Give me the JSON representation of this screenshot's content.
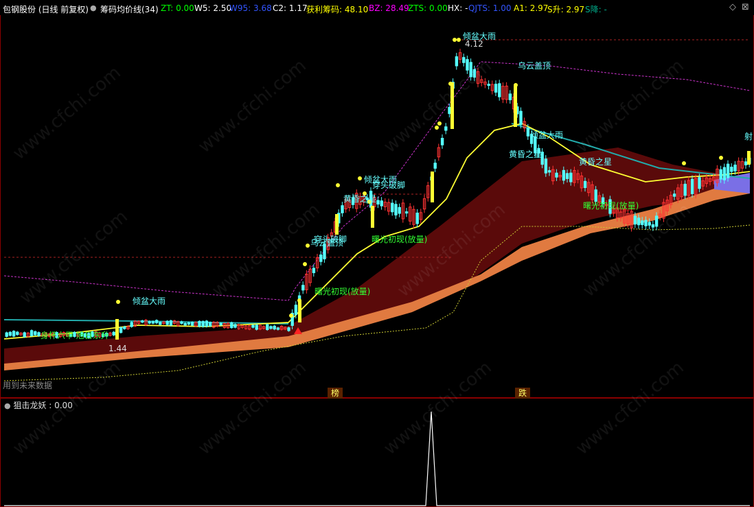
{
  "header": {
    "stock_title": "包钢股份 (日线 前复权)",
    "indicator_name": "筹码均价线(34)",
    "params": [
      {
        "label": "ZT: 0.00",
        "color": "#00ff00"
      },
      {
        "label": "W5: 2.50",
        "color": "#ffffff"
      },
      {
        "label": "W95: 3.68",
        "color": "#3355ff"
      },
      {
        "label": "C2: 1.17",
        "color": "#ffffff"
      },
      {
        "label": "获利筹码: 48.10",
        "color": "#ffff00"
      },
      {
        "label": "BZ: 28.49",
        "color": "#ff00ff"
      },
      {
        "label": "ZTS: 0.00",
        "color": "#00ff00"
      },
      {
        "label": "HX: -",
        "color": "#ffffff"
      },
      {
        "label": "QJTS: 1.00",
        "color": "#3355ff"
      },
      {
        "label": "A1: 2.97",
        "color": "#ffff00"
      },
      {
        "label": "S升: 2.97",
        "color": "#ffff00"
      },
      {
        "label": "S降: -",
        "color": "#00aa88"
      }
    ]
  },
  "main_chart": {
    "high_price_label": "4.12",
    "low_price_label": "1.44",
    "future_data_note": "用到未来数据",
    "pills": [
      "榜",
      "跌"
    ],
    "annotations": [
      {
        "text": "倾盆大雨",
        "color": "#66ffff"
      },
      {
        "text": "乌云盖顶",
        "color": "#66ffff"
      },
      {
        "text": "倾盆大雨",
        "color": "#66ffff"
      },
      {
        "text": "黄昏之星",
        "color": "#66ffff"
      },
      {
        "text": "曙光初现(放量)",
        "color": "#33ff33"
      },
      {
        "text": "倾盆大雨",
        "color": "#66ffff"
      },
      {
        "text": "穿头破脚",
        "color": "#66ffff"
      },
      {
        "text": "黄昏之星",
        "color": "#66ffff"
      },
      {
        "text": "曙光初现(放量)",
        "color": "#33ff33"
      },
      {
        "text": "穿头破脚",
        "color": "#66ffff"
      },
      {
        "text": "乌云盖顶",
        "color": "#66ffff"
      },
      {
        "text": "曙光初现(放量)",
        "color": "#33ff33"
      },
      {
        "text": "倾盆大雨",
        "color": "#66ffff"
      },
      {
        "text": "身怀六甲 旭日东升",
        "color": "#33ff33"
      },
      {
        "text": "黄昏之星",
        "color": "#66ffff"
      },
      {
        "text": "曙光初现(放量)",
        "color": "#33ff33"
      },
      {
        "text": "射",
        "color": "#66ffff"
      }
    ]
  },
  "indicator_panel": {
    "title": "狙击龙妖 : 0.00"
  },
  "watermark": "www.cfchi.com",
  "colors": {
    "up_candle": "#ff3333",
    "down_candle": "#55ffff",
    "cost_line": "#ffff33",
    "chip_fill_dark": "#5a0a0a",
    "chip_fill_orange": "#e07a40",
    "chip_fill_blue": "#7a6fe6",
    "panel_border": "#8a0000"
  }
}
